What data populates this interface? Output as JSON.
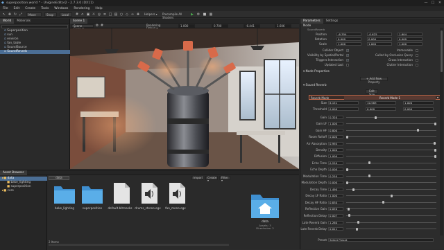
{
  "window": {
    "title": "superposition.world * - UnigineEditor2 - 2.7.3.0 (DX11)",
    "buttons": [
      "—",
      "□",
      "✕"
    ]
  },
  "menu": [
    "File",
    "Edit",
    "Create",
    "Tools",
    "Windows",
    "Rendering",
    "Help"
  ],
  "toolbar": {
    "move_label": "Move",
    "snap_label": "Snap",
    "local_label": "Local",
    "helpers_label": "Helpers ▾",
    "precompile_label": "Precompile All Shaders"
  },
  "world_panel": {
    "tabs": [
      "World",
      "Materials"
    ],
    "search_placeholder": "",
    "nodes": [
      {
        "label": "Superposition",
        "selected": false
      },
      {
        "label": "sun",
        "selected": false
      },
      {
        "label": "environ",
        "selected": false
      },
      {
        "label": "fan_table",
        "selected": false
      },
      {
        "label": "SoundSource",
        "selected": false
      },
      {
        "label": "SoundReverb",
        "selected": true
      }
    ]
  },
  "viewport": {
    "tab": "Scene 1",
    "camera_label": "Scene Camera ▾",
    "rendering_label": "Rendering Debug ▾",
    "coords": [
      "1.000",
      "0.700",
      "-6.441",
      "1.606"
    ]
  },
  "parameters": {
    "tabs": [
      "Parameters",
      "Settings"
    ],
    "node_header": "Node",
    "node_sub": "SoundReverb",
    "transform": [
      {
        "label": "Position",
        "values": [
          "-6.354",
          "-0.625",
          "1.604"
        ]
      },
      {
        "label": "Rotation",
        "values": [
          "0.000",
          "0.000",
          "0.000"
        ]
      },
      {
        "label": "Scale",
        "values": [
          "1.000",
          "1.000",
          "1.000"
        ]
      }
    ],
    "flags_left": [
      {
        "label": "Collider Object",
        "checked": true
      },
      {
        "label": "Visibility by Spatial/Portal",
        "checked": true
      },
      {
        "label": "Triggers Interaction",
        "checked": true
      },
      {
        "label": "Updated Last",
        "checked": false
      }
    ],
    "flags_right": [
      {
        "label": "Immovable",
        "checked": false
      },
      {
        "label": "Culled by Occlusion Query",
        "checked": false
      },
      {
        "label": "Grass Interaction",
        "checked": false
      },
      {
        "label": "Clutter Interaction",
        "checked": false
      }
    ],
    "node_properties_header": "Node Properties",
    "add_property_label": "Add New Property",
    "sound_reverb_header": "Sound Reverb",
    "edit_size_label": "Edit Size",
    "reverb_mode_label": "Reverb Mode",
    "reverb_mode_value": "Reverb Mode 1",
    "size": {
      "label": "Size",
      "values": [
        "6.151",
        "10.583",
        "1.000"
      ]
    },
    "threshold": {
      "label": "Threshold",
      "values": [
        "0.000",
        "0.000",
        "0.000"
      ]
    },
    "sliders": [
      {
        "label": "Gain",
        "value": "0.320",
        "fraction": 0.32
      },
      {
        "label": "Gain LF",
        "value": "1.000",
        "fraction": 1.0
      },
      {
        "label": "Gain HF",
        "value": "0.800",
        "fraction": 0.8
      },
      {
        "label": "Room Rolloff",
        "value": "0.000",
        "fraction": 0.0
      },
      {
        "label": "Air Absorption",
        "value": "0.994",
        "fraction": 0.99
      },
      {
        "label": "Density",
        "value": "1.000",
        "fraction": 1.0
      },
      {
        "label": "Diffusion",
        "value": "1.000",
        "fraction": 1.0
      },
      {
        "label": "Echo Time",
        "value": "0.250",
        "fraction": 0.25
      },
      {
        "label": "Echo Depth",
        "value": "0.000",
        "fraction": 0.0
      },
      {
        "label": "Modulation Time",
        "value": "0.250",
        "fraction": 0.25
      },
      {
        "label": "Modulation Depth",
        "value": "0.000",
        "fraction": 0.0
      },
      {
        "label": "Decay Time",
        "value": "1.490",
        "fraction": 0.07
      },
      {
        "label": "Decay LF Ratio",
        "value": "1.000",
        "fraction": 0.5
      },
      {
        "label": "Decay HF Ratio",
        "value": "0.830",
        "fraction": 0.41
      },
      {
        "label": "Reflection Gain",
        "value": "0.050",
        "fraction": 0.016
      },
      {
        "label": "Reflection Delay",
        "value": "0.007",
        "fraction": 0.023
      },
      {
        "label": "Late Reverb Gain",
        "value": "1.260",
        "fraction": 0.126
      },
      {
        "label": "Late Reverb Delay",
        "value": "0.011",
        "fraction": 0.11
      }
    ],
    "preset_label": "Preset",
    "preset_value": "Select Preset"
  },
  "asset_browser": {
    "title": "Asset Browser",
    "tree": [
      {
        "label": "data",
        "selected": true
      },
      {
        "label": "bake_lighting",
        "selected": false
      },
      {
        "label": "superposition",
        "selected": false
      },
      {
        "label": "core",
        "selected": false
      }
    ],
    "path": "data",
    "import_label": "Import",
    "create_label": "Create ▾",
    "filter_label": "Filter ▾",
    "items": [
      {
        "label": "bake_lighting",
        "kind": "folder"
      },
      {
        "label": "superposition",
        "kind": "folder"
      },
      {
        "label": "default.bitmasks",
        "kind": "file"
      },
      {
        "label": "drums_stereo.ogx",
        "kind": "audio"
      },
      {
        "label": "fan_mono.ogx",
        "kind": "audio"
      }
    ],
    "status": "2 Items",
    "preview": {
      "name": "data",
      "line1": "Assets: 3",
      "line2": "Directories: 2"
    }
  }
}
